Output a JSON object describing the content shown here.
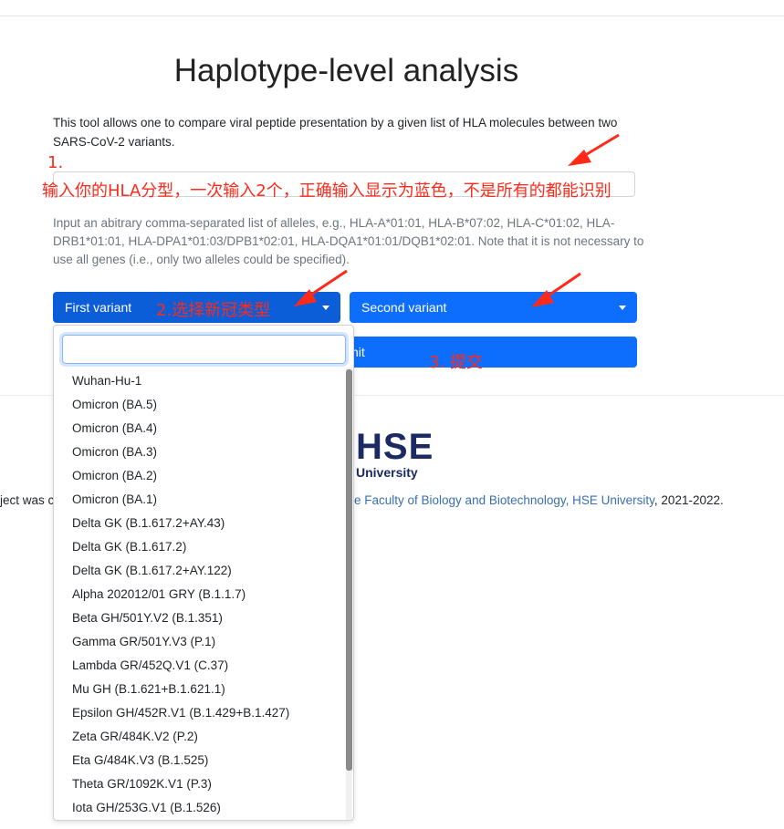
{
  "page": {
    "title": "Haplotype-level analysis",
    "description": "This tool allows one to compare viral peptide presentation by a given list of HLA molecules between two SARS-CoV-2 variants.",
    "help_text": "Input an abitrary comma-separated list of alleles, e.g., HLA-A*01:01, HLA-B*07:02, HLA-C*01:02, HLA-DRB1*01:01, HLA-DPA1*01:03/DPB1*02:01, HLA-DQA1*01:01/DQB1*02:01. Note that it is not necessary to use all genes (i.e., only two alleles could be specified).",
    "first_variant_label": "First variant",
    "second_variant_label": "Second variant",
    "submit_label_visible": "nit"
  },
  "footer": {
    "logo_text": "HSE",
    "logo_subtext": "University",
    "left_fragment": "ject was c",
    "link_text": "e Faculty of Biology and Biotechnology, HSE University",
    "years": ", 2021-2022."
  },
  "dropdown": {
    "search_value": "",
    "items": [
      "Wuhan-Hu-1",
      "Omicron (BA.5)",
      "Omicron (BA.4)",
      "Omicron (BA.3)",
      "Omicron (BA.2)",
      "Omicron (BA.1)",
      "Delta GK (B.1.617.2+AY.43)",
      "Delta GK (B.1.617.2)",
      "Delta GK (B.1.617.2+AY.122)",
      "Alpha 202012/01 GRY (B.1.1.7)",
      "Beta GH/501Y.V2 (B.1.351)",
      "Gamma GR/501Y.V3 (P.1)",
      "Lambda GR/452Q.V1 (C.37)",
      "Mu GH (B.1.621+B.1.621.1)",
      "Epsilon GH/452R.V1 (B.1.429+B.1.427)",
      "Zeta GR/484K.V2 (P.2)",
      "Eta G/484K.V3 (B.1.525)",
      "Theta GR/1092K.V1 (P.3)",
      "Iota GH/253G.V1 (B.1.526)"
    ]
  },
  "annotations": {
    "step1_number": "1.",
    "step1_text": "输入你的HLA分型，一次输入2个，正确输入显示为蓝色，不是所有的都能识别",
    "step2_text": "2.选择新冠类型",
    "step3_text": "3. 提交",
    "color": "#ff2a1a"
  },
  "colors": {
    "primary": "#0d6efd",
    "primary_active": "#0b5ed7",
    "hse_navy": "#1b2a62",
    "link": "#3a6fb0"
  }
}
